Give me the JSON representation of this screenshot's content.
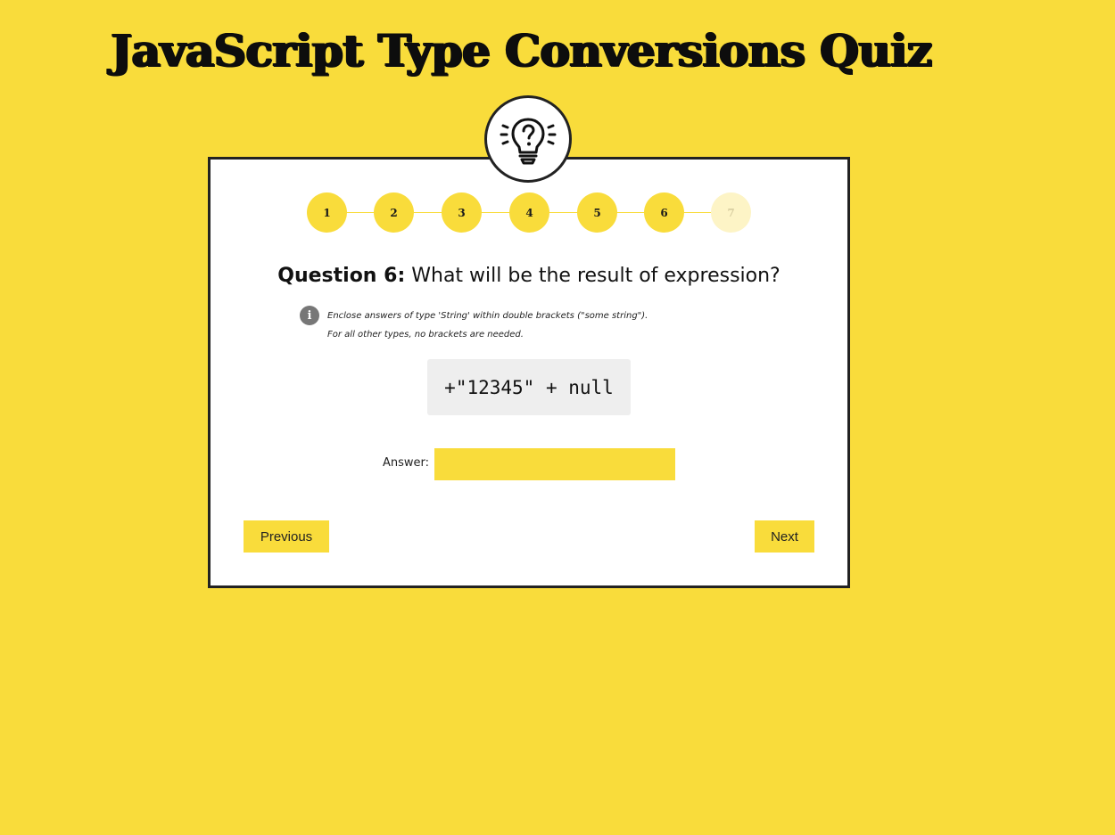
{
  "page": {
    "title": "JavaScript Type Conversions Quiz"
  },
  "badge": {
    "icon": "lightbulb-question-icon"
  },
  "steps": [
    {
      "label": "1",
      "state": "done"
    },
    {
      "label": "2",
      "state": "done"
    },
    {
      "label": "3",
      "state": "done"
    },
    {
      "label": "4",
      "state": "done"
    },
    {
      "label": "5",
      "state": "done"
    },
    {
      "label": "6",
      "state": "current"
    },
    {
      "label": "7",
      "state": "pending"
    }
  ],
  "question": {
    "prefix": "Question 6",
    "separator": ":",
    "text": " What will be the result of expression?"
  },
  "hint": {
    "icon": "info-icon",
    "icon_glyph": "i",
    "line1": "Enclose answers of type 'String' within double brackets (\"some string\").",
    "line2": "For all other types, no brackets are needed."
  },
  "expression": "+\"12345\" + null",
  "answer": {
    "label": "Answer:",
    "value": "",
    "placeholder": ""
  },
  "nav": {
    "previous_label": "Previous",
    "next_label": "Next"
  },
  "colors": {
    "background": "#f9dc3b",
    "accent": "#f9dc3b",
    "pending_step": "#fdf4c6",
    "border": "#222222",
    "code_bg": "#eeeeee"
  }
}
